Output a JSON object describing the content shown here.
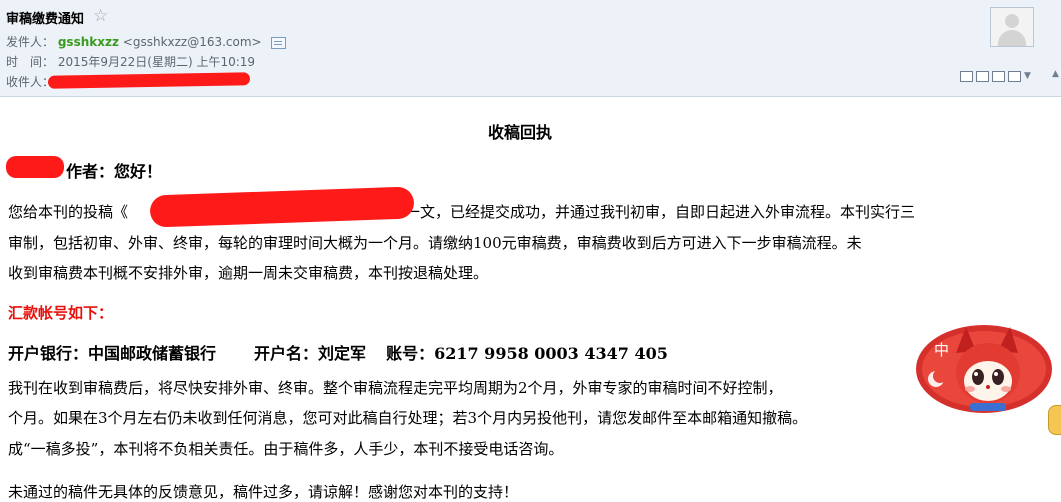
{
  "header": {
    "subject": "审稿缴费通知",
    "from_label": "发件人：",
    "from_name": "gsshkxzz",
    "from_email": "<gsshkxzz@163.com>",
    "time_label": "时　间：",
    "time_value": "2015年9月22日(星期二) 上午10:19",
    "to_label": "收件人："
  },
  "body": {
    "title": "收稿回执",
    "greeting": "作者：您好！",
    "line1_pre": "您给本刊的投稿《",
    "line1_post": "》一文，已经提交成功，并通过我刊初审，自即日起进入外审流程。本刊实行三",
    "line2": "审制，包括初审、外审、终审，每轮的审理时间大概为一个月。请缴纳100元审稿费，审稿费收到后方可进入下一步审稿流程。未",
    "line3": "收到审稿费本刊概不安排外审，逾期一周未交审稿费，本刊按退稿处理。",
    "account_heading": "汇款帐号如下：",
    "bank_label": "开户银行：",
    "bank_value": "中国邮政储蓄银行",
    "holder_label": "开户名：",
    "holder_value": "刘定军",
    "account_label": "账号：",
    "account_value": "6217 9958 0003 4347 405",
    "para2_line1": "我刊在收到审稿费后，将尽快安排外审、终审。整个审稿流程走完平均周期为2个月，外审专家的审稿时间不好控制，",
    "para2_line2": "个月。如果在3个月左右仍未收到任何消息，您可对此稿自行处理；若3个月内另投他刊，请您发邮件至本邮箱通知撤稿。",
    "para2_line3": "成“一稿多投”，本刊将不负相关责任。由于稿件多，人手少，本刊不接受电话咨询。",
    "closing": "未通过的稿件无具体的反馈意见，稿件过多，请谅解！感谢您对本刊的支持！"
  },
  "widget": {
    "label": "中"
  },
  "colors": {
    "header_bg": "#ecf2f8",
    "sender_green": "#3a9a1e",
    "heading_red": "#e8100b",
    "redaction_red": "#ff1a1a"
  }
}
